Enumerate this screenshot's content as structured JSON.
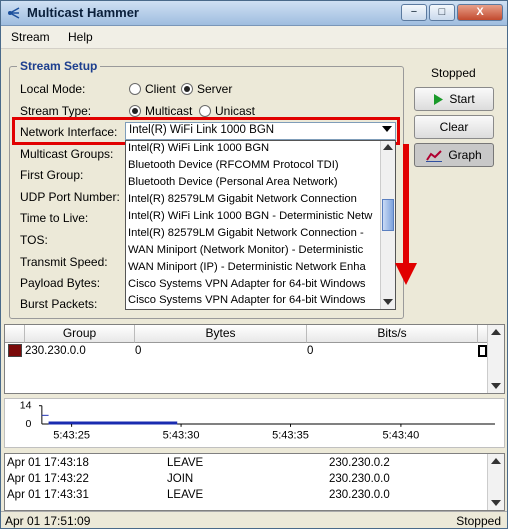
{
  "window": {
    "title": "Multicast Hammer",
    "min": "−",
    "max": "□",
    "close": "X"
  },
  "menu": [
    "Stream",
    "Help"
  ],
  "setup": {
    "title": "Stream Setup",
    "local_mode_label": "Local Mode:",
    "client": "Client",
    "server": "Server",
    "stream_type_label": "Stream Type:",
    "multicast": "Multicast",
    "unicast": "Unicast",
    "network_interface_label": "Network Interface:",
    "network_interface_value": "Intel(R) WiFi Link 1000 BGN",
    "multicast_groups_label": "Multicast Groups:",
    "first_group_label": "First Group:",
    "udp_port_label": "UDP Port Number:",
    "ttl_label": "Time to Live:",
    "tos_label": "TOS:",
    "transmit_speed_label": "Transmit Speed:",
    "payload_bytes_label": "Payload Bytes:",
    "burst_packets_label": "Burst Packets:"
  },
  "dropdown": {
    "items": [
      "Intel(R) WiFi Link 1000 BGN",
      "Bluetooth Device (RFCOMM Protocol TDI)",
      "Bluetooth Device (Personal Area Network)",
      "Intel(R) 82579LM Gigabit Network Connection",
      "Intel(R) WiFi Link 1000 BGN - Deterministic Netw",
      "Intel(R) 82579LM Gigabit Network Connection -",
      "WAN Miniport (Network Monitor) - Deterministic",
      "WAN Miniport (IP) - Deterministic Network Enha",
      "Cisco Systems VPN Adapter for 64-bit Windows",
      "Cisco Systems VPN Adapter for 64-bit Windows"
    ]
  },
  "side": {
    "status": "Stopped",
    "start": "Start",
    "clear": "Clear",
    "graph": "Graph"
  },
  "table": {
    "headers": [
      "Group",
      "Bytes",
      "Bits/s"
    ],
    "rows": [
      {
        "group": "230.230.0.0",
        "bytes": "0",
        "bits": "0",
        "color": "#7a0a0a"
      }
    ]
  },
  "graph": {
    "y_ticks": [
      "14",
      "0"
    ],
    "x_ticks": [
      "5:43:25",
      "5:43:30",
      "5:43:35",
      "5:43:40"
    ]
  },
  "log": [
    {
      "time": "Apr 01 17:43:18",
      "event": "LEAVE",
      "group": "230.230.0.2"
    },
    {
      "time": "Apr 01 17:43:22",
      "event": "JOIN",
      "group": "230.230.0.0"
    },
    {
      "time": "Apr 01 17:43:31",
      "event": "LEAVE",
      "group": "230.230.0.0"
    }
  ],
  "statusbar": {
    "time": "Apr 01 17:51:09",
    "status": "Stopped"
  }
}
